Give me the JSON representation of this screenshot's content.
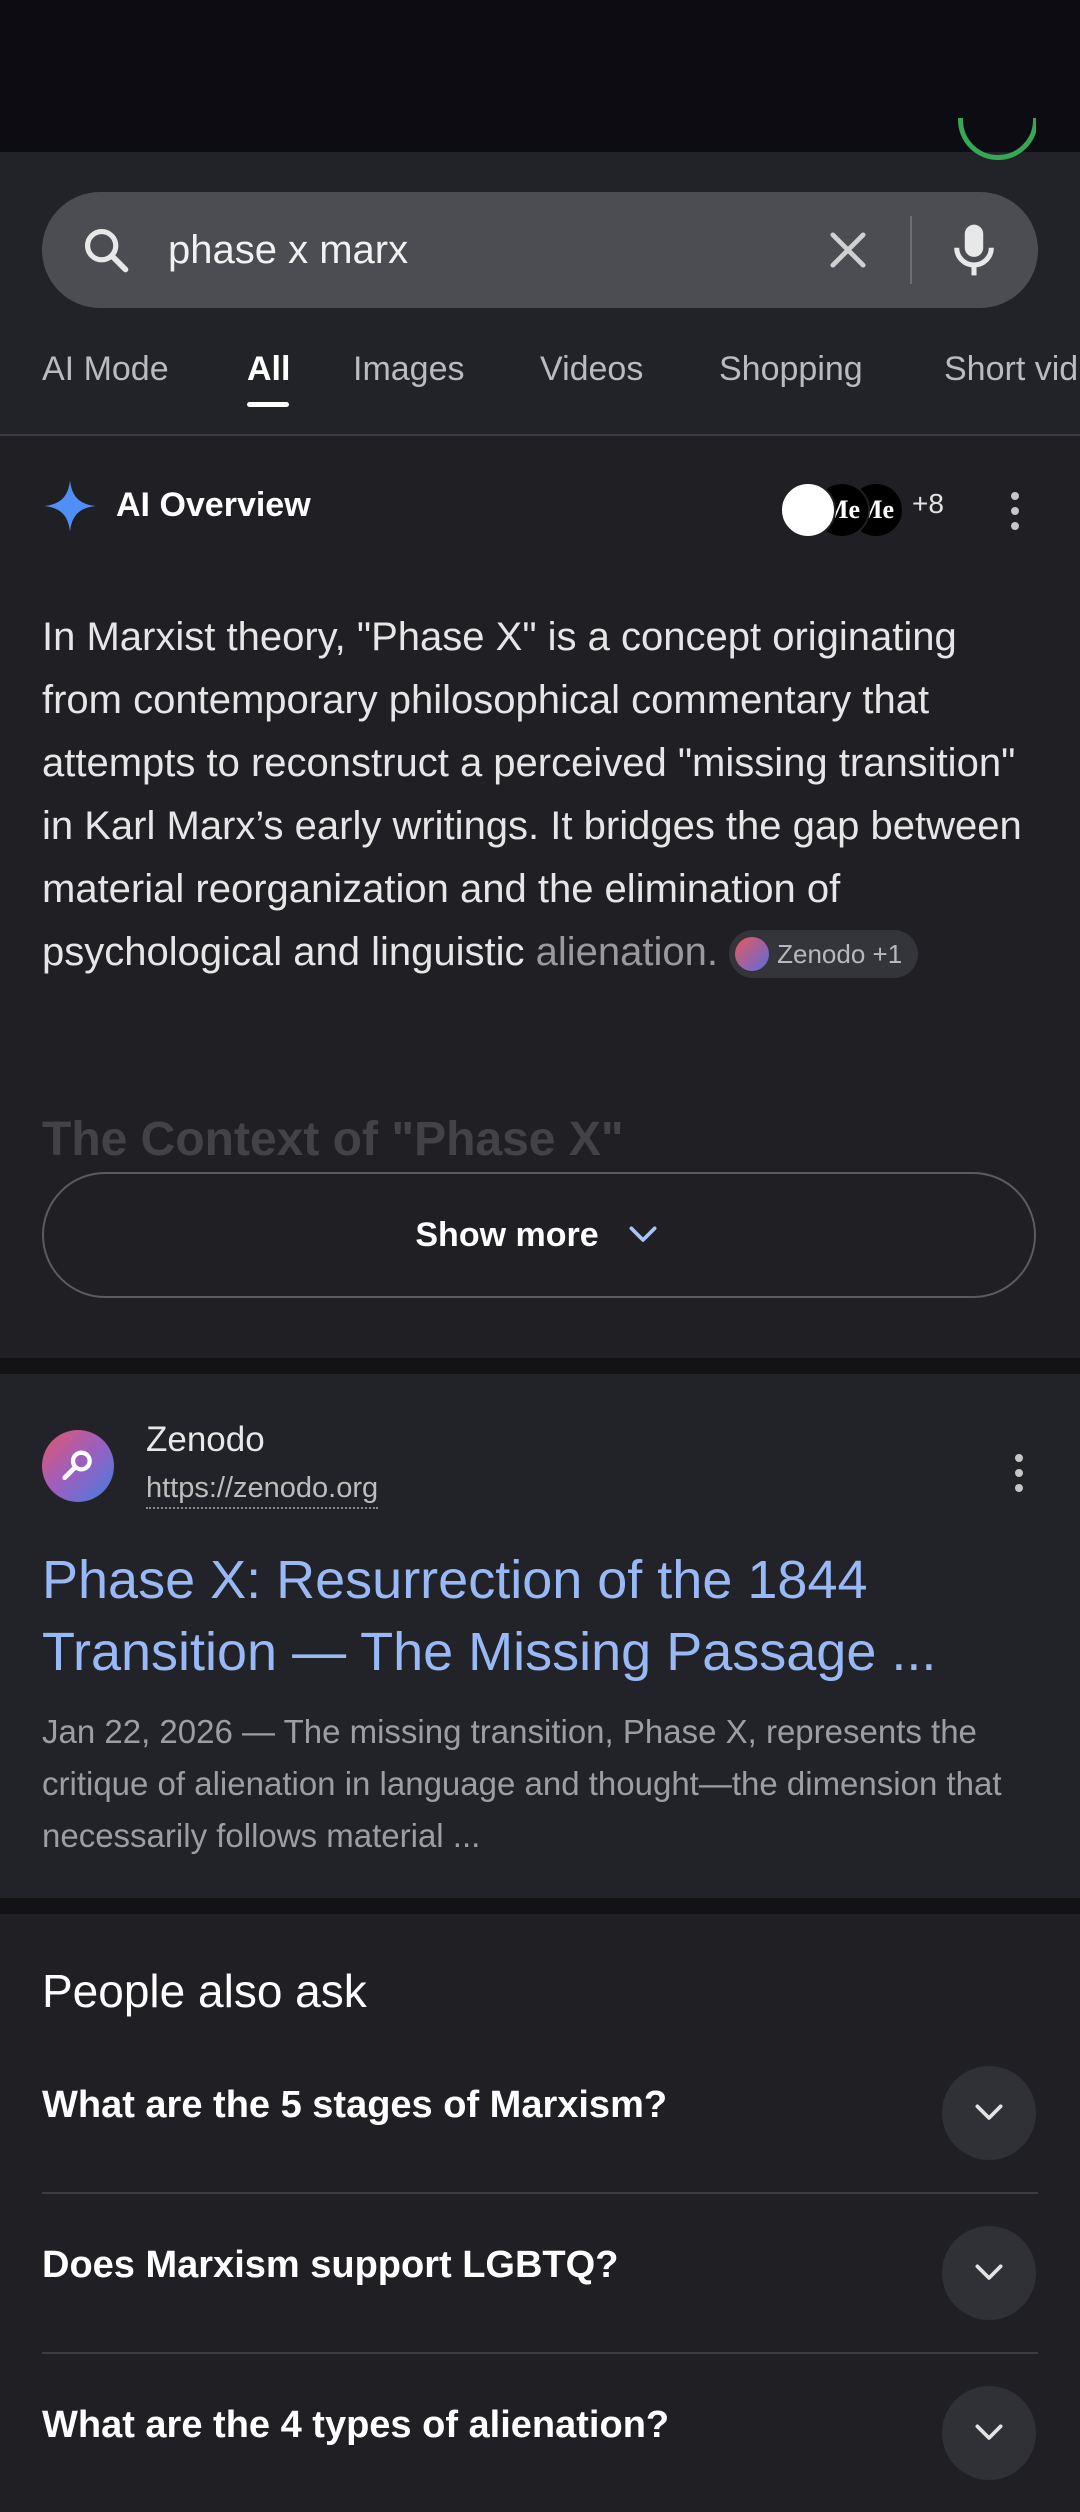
{
  "search": {
    "query": "phase x marx"
  },
  "tabs": [
    {
      "label": "AI Mode",
      "active": false
    },
    {
      "label": "All",
      "active": true
    },
    {
      "label": "Images",
      "active": false
    },
    {
      "label": "Videos",
      "active": false
    },
    {
      "label": "Shopping",
      "active": false
    },
    {
      "label": "Short vid",
      "active": false
    }
  ],
  "ai_overview": {
    "title": "AI Overview",
    "source_avatars": [
      "",
      "Me",
      "Me"
    ],
    "more_sources": "+8",
    "body": "In Marxist theory, \"Phase X\" is a concept originating from contemporary philosophical commentary that attempts to reconstruct a perceived \"missing transition\" in Karl Marx’s early writings. It bridges the gap between material reorganization and the elimination of psychological and linguistic",
    "body_end": "alienation.",
    "source_chip": "Zenodo +1",
    "faded_heading": "The Context of \"Phase X\"",
    "show_more": "Show more"
  },
  "result": {
    "site_name": "Zenodo",
    "url": "https://zenodo.org",
    "title": "Phase X: Resurrection of the 1844 Transition — The Missing Passage ...",
    "snippet": "Jan 22, 2026 — The missing transition, Phase X, represents the critique of alienation in language and thought—the dimension that necessarily follows material ..."
  },
  "people_also_ask": {
    "title": "People also ask",
    "questions": [
      "What are the 5 stages of Marxism?",
      "Does Marxism support LGBTQ?",
      "What are the 4 types of alienation?"
    ]
  },
  "colors": {
    "background": "#1f1f24",
    "link": "#99b9f6",
    "search_bar": "#4b4d52",
    "accent_green": "#34a853",
    "sparkle": "#4f8ff7"
  }
}
